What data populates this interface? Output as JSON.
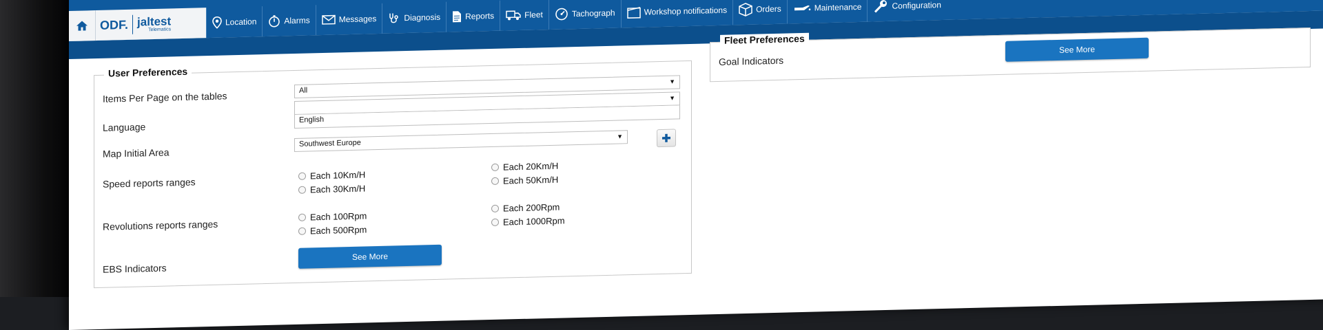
{
  "nav": {
    "items": [
      {
        "label": "Location",
        "icon": "map-pin-icon"
      },
      {
        "label": "Alarms",
        "icon": "stopwatch-icon"
      },
      {
        "label": "Messages",
        "icon": "envelope-icon"
      },
      {
        "label": "Diagnosis",
        "icon": "stethoscope-icon"
      },
      {
        "label": "Reports",
        "icon": "document-icon"
      },
      {
        "label": "Fleet",
        "icon": "truck-icon"
      },
      {
        "label": "Tachograph",
        "icon": "tachograph-icon"
      },
      {
        "label": "Workshop notifications",
        "icon": "clipboard-icon"
      },
      {
        "label": "Orders",
        "icon": "box-icon"
      },
      {
        "label": "Maintenance",
        "icon": "oil-can-icon"
      },
      {
        "label": "Configuration",
        "icon": "wrench-icon"
      }
    ],
    "logo": {
      "odf": "ODF.",
      "brand": "jaltest",
      "sub": "Telematics"
    }
  },
  "user_prefs": {
    "title": "User Preferences",
    "items_per_page": {
      "label": "Items Per Page on the tables",
      "value": "All"
    },
    "language": {
      "label": "Language",
      "value": "English"
    },
    "map_area": {
      "label": "Map Initial Area",
      "value": "Southwest Europe"
    },
    "speed": {
      "label": "Speed reports ranges",
      "options": [
        "Each 10Km/H",
        "Each 30Km/H",
        "Each 20Km/H",
        "Each 50Km/H"
      ]
    },
    "revolutions": {
      "label": "Revolutions reports ranges",
      "options": [
        "Each 100Rpm",
        "Each 500Rpm",
        "Each 200Rpm",
        "Each 1000Rpm"
      ]
    },
    "ebs": {
      "label": "EBS Indicators",
      "button": "See More"
    }
  },
  "fleet_prefs": {
    "title": "Fleet Preferences",
    "goal": {
      "label": "Goal Indicators",
      "button": "See More"
    }
  },
  "colors": {
    "primary": "#0f5a9e",
    "button": "#1a74c0"
  }
}
